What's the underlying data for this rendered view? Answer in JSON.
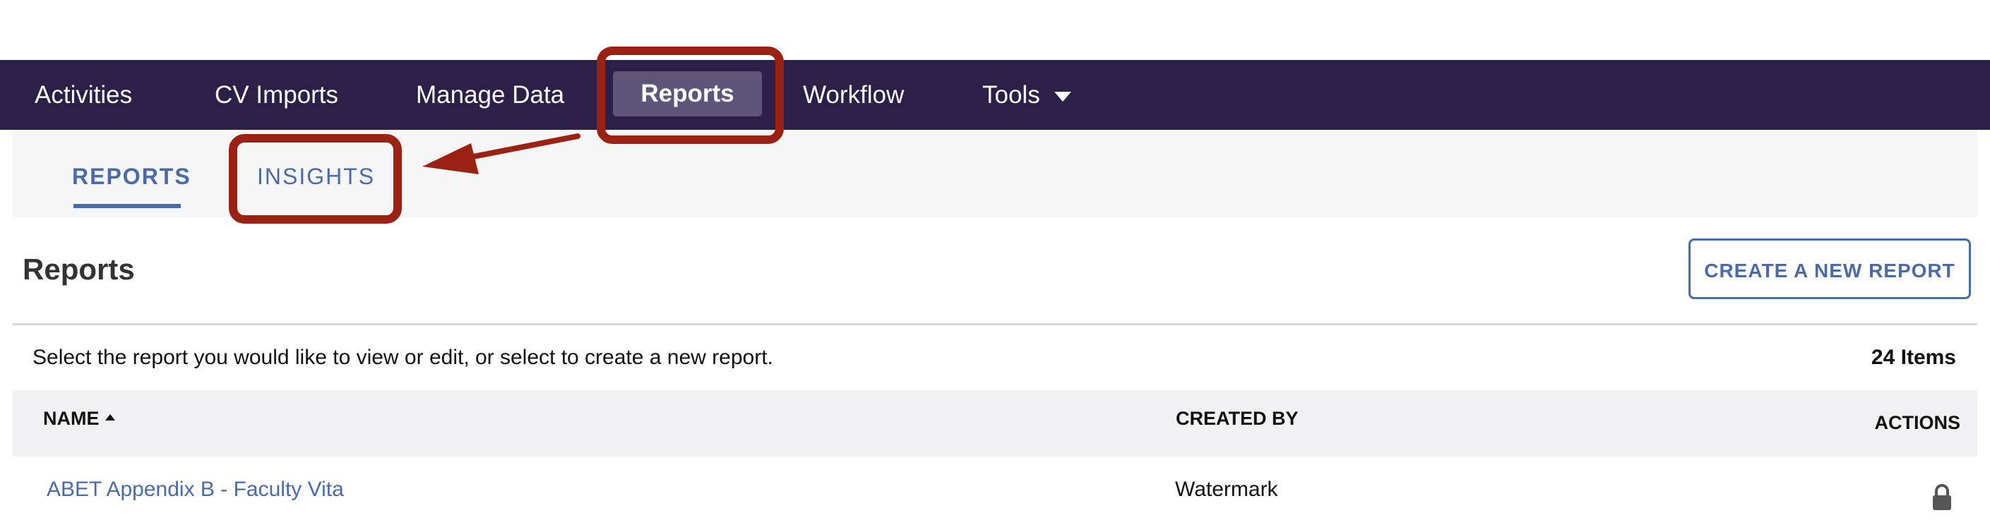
{
  "topnav": {
    "items": [
      {
        "label": "Activities"
      },
      {
        "label": "CV Imports"
      },
      {
        "label": "Manage Data"
      },
      {
        "label": "Reports",
        "active": true
      },
      {
        "label": "Workflow"
      },
      {
        "label": "Tools",
        "has_dropdown": true
      }
    ],
    "colors": {
      "background": "#2c2049",
      "active": "#5f5578"
    }
  },
  "subnav": {
    "tabs": [
      {
        "label": "REPORTS",
        "active": true
      },
      {
        "label": "INSIGHTS",
        "active": false
      }
    ]
  },
  "page": {
    "title": "Reports",
    "create_button": "CREATE A NEW REPORT",
    "instructions": "Select the report you would like to view or edit, or select to create a new report.",
    "item_count": "24 Items"
  },
  "table": {
    "columns": [
      "NAME",
      "CREATED BY",
      "ACTIONS"
    ],
    "sort": {
      "column": "NAME",
      "direction": "ascending"
    },
    "rows": [
      {
        "name": "ABET Appendix B - Faculty Vita",
        "created_by": "Watermark",
        "action_icon": "lock-icon"
      }
    ]
  },
  "annotations": {
    "color": "#9b2113",
    "highlights": [
      "Reports",
      "INSIGHTS"
    ],
    "arrow": "from Reports highlight to INSIGHTS highlight"
  }
}
